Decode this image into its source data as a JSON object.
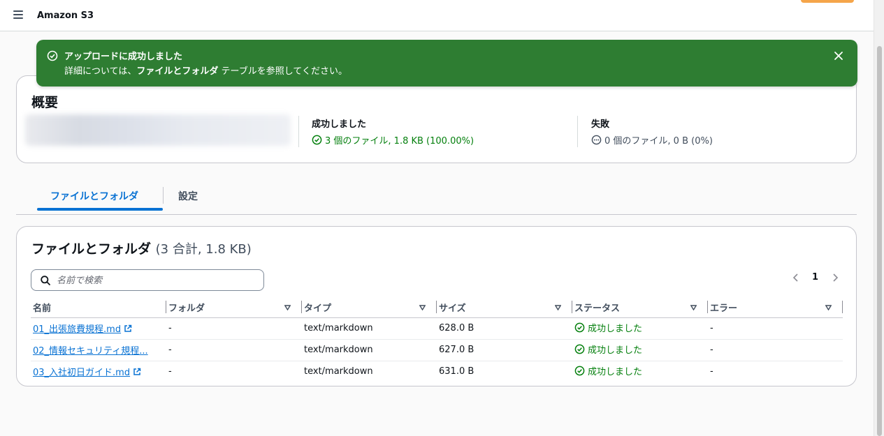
{
  "app": {
    "title": "Amazon S3"
  },
  "flash": {
    "title": "アップロードに成功しました",
    "body_prefix": "詳細については、",
    "body_bold": "ファイルとフォルダ",
    "body_suffix": " テーブルを参照してください。"
  },
  "summary": {
    "title": "概要",
    "success_label": "成功しました",
    "success_value": "3 個のファイル, 1.8 KB (100.00%)",
    "failed_label": "失敗",
    "failed_value": "0 個のファイル, 0 B (0%)"
  },
  "tabs": {
    "files": "ファイルとフォルダ",
    "settings": "設定"
  },
  "files": {
    "title": "ファイルとフォルダ",
    "count": "(3 合計, 1.8 KB)",
    "search_placeholder": "名前で検索",
    "page": "1",
    "columns": [
      "名前",
      "フォルダ",
      "タイプ",
      "サイズ",
      "ステータス",
      "エラー"
    ],
    "rows": [
      {
        "name": "01_出張旅費規程.md",
        "folder": "-",
        "type": "text/markdown",
        "size": "628.0 B",
        "status": "成功しました",
        "error": "-"
      },
      {
        "name": "02_情報セキュリティ規程...",
        "folder": "-",
        "type": "text/markdown",
        "size": "627.0 B",
        "status": "成功しました",
        "error": "-"
      },
      {
        "name": "03_入社初日ガイド.md",
        "folder": "-",
        "type": "text/markdown",
        "size": "631.0 B",
        "status": "成功しました",
        "error": "-"
      }
    ]
  },
  "colors": {
    "success": "#037f0c",
    "flash_bg": "#2e7d32",
    "link": "#0972d3"
  }
}
